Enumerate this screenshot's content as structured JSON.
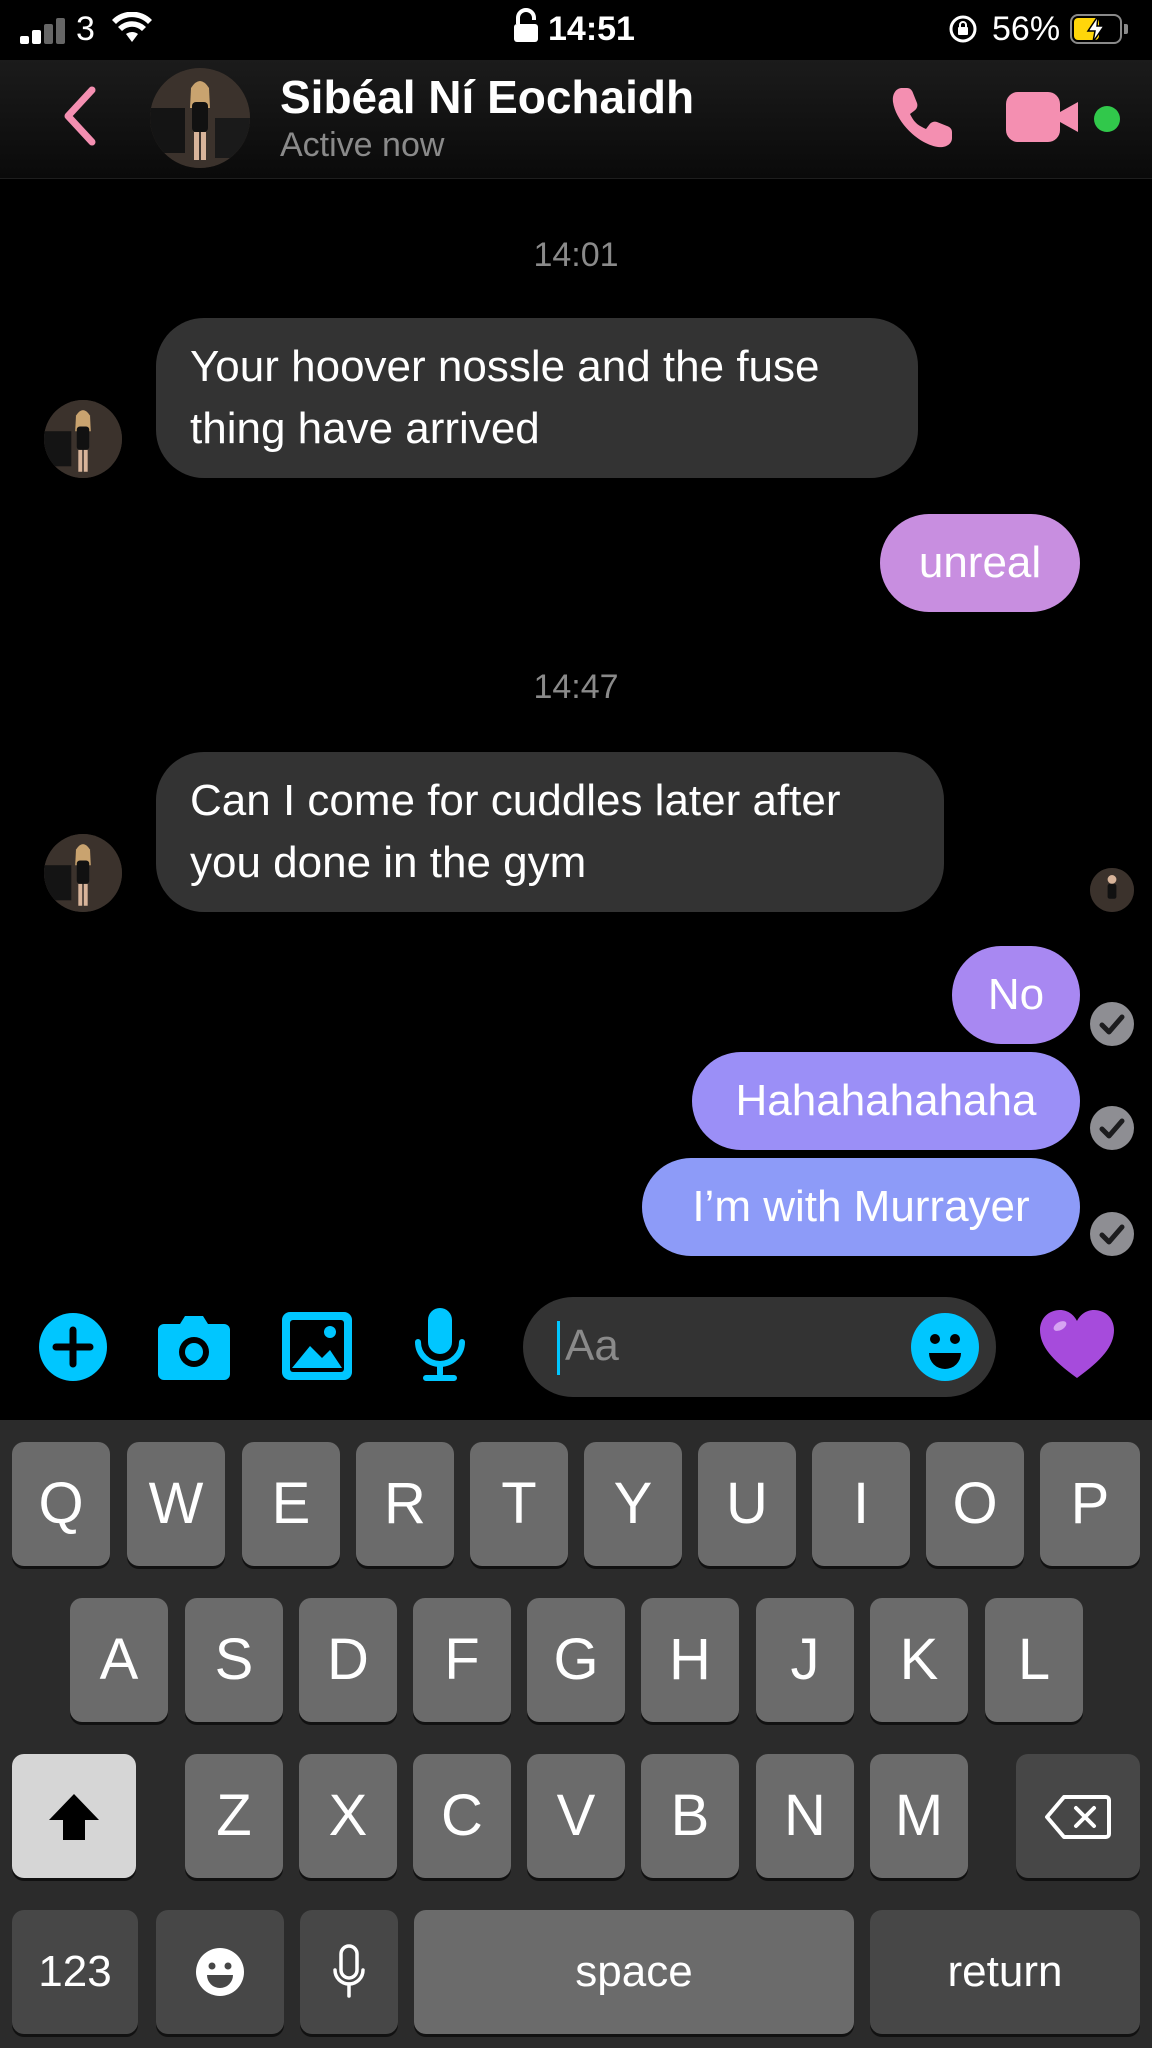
{
  "status_bar": {
    "carrier": "3",
    "time": "14:51",
    "battery_percent": "56%",
    "battery_level": 0.56,
    "battery_color": "#ffd60a"
  },
  "header": {
    "contact_name": "Sibéal Ní Eochaidh",
    "presence": "Active now",
    "accent_color": "#f48fb1",
    "online_color": "#31c84b"
  },
  "conversation": {
    "timestamp_1": "14:01",
    "incoming_1": "Your hoover nossle and the fuse thing have arrived",
    "outgoing_1": "unreal",
    "timestamp_2": "14:47",
    "incoming_2": "Can I come for cuddles later after you done in the gym",
    "outgoing_2": "No",
    "outgoing_3": "Hahahahahaha",
    "outgoing_4": "I’m with Murrayer"
  },
  "composer": {
    "placeholder": "Aa",
    "icons": [
      "plus-icon",
      "camera-icon",
      "image-icon",
      "microphone-icon",
      "emoji-icon",
      "purple-heart-icon"
    ],
    "icon_color": "#00c6ff"
  },
  "keyboard": {
    "row1": [
      "Q",
      "W",
      "E",
      "R",
      "T",
      "Y",
      "U",
      "I",
      "O",
      "P"
    ],
    "row2": [
      "A",
      "S",
      "D",
      "F",
      "G",
      "H",
      "J",
      "K",
      "L"
    ],
    "row3": [
      "Z",
      "X",
      "C",
      "V",
      "B",
      "N",
      "M"
    ],
    "numbers_key": "123",
    "space_key": "space",
    "return_key": "return"
  }
}
